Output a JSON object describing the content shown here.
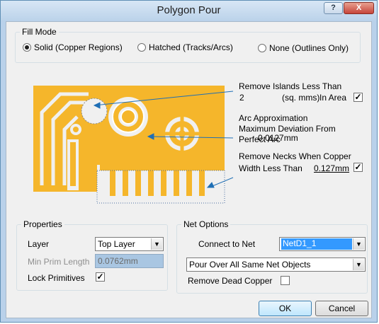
{
  "window": {
    "title": "Polygon Pour",
    "help_label": "?",
    "close_label": "X"
  },
  "fill_mode": {
    "legend": "Fill Mode",
    "options": [
      "Solid (Copper Regions)",
      "Hatched (Tracks/Arcs)",
      "None (Outlines Only)"
    ],
    "selected": 0
  },
  "diagram": {
    "copper_color": "#f5b62b",
    "remove_islands": {
      "label": "Remove Islands Less Than",
      "value": "2",
      "unit": "(sq. mms)",
      "scope": "In Area",
      "checked": true
    },
    "arc_approx": {
      "label_line1": "Arc Approximation",
      "label_line2": "Maximum Deviation From",
      "label_line3": "Perfect Arc",
      "value": "0.0127mm"
    },
    "remove_necks": {
      "label_line1": "Remove Necks When Copper",
      "label_line2": "Width Less Than",
      "value": "0.127mm",
      "checked": true
    }
  },
  "properties": {
    "legend": "Properties",
    "layer_label": "Layer",
    "layer_value": "Top Layer",
    "min_prim_label": "Min Prim Length",
    "min_prim_value": "0.0762mm",
    "lock_label": "Lock Primitives",
    "lock_checked": true
  },
  "net_options": {
    "legend": "Net Options",
    "connect_label": "Connect to Net",
    "connect_value": "NetD1_1",
    "pour_value": "Pour Over All Same Net Objects",
    "remove_dead_label": "Remove Dead Copper",
    "remove_dead_checked": false
  },
  "buttons": {
    "ok": "OK",
    "cancel": "Cancel"
  }
}
